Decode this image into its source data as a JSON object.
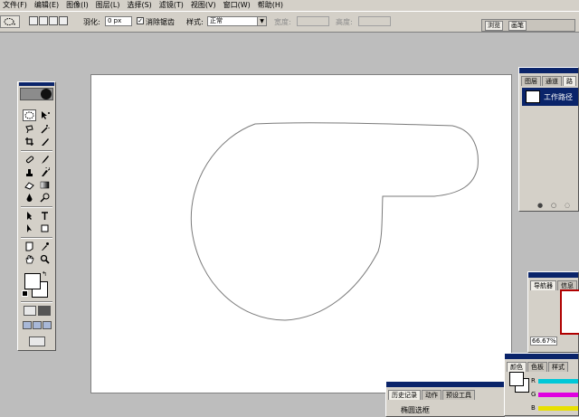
{
  "menu": [
    "文件(F)",
    "编辑(E)",
    "图像(I)",
    "图层(L)",
    "选择(S)",
    "滤镜(T)",
    "视图(V)",
    "窗口(W)",
    "帮助(H)"
  ],
  "options": {
    "feather_label": "羽化:",
    "feather_value": "0 px",
    "antialias_label": "消除锯齿",
    "antialias_checked": "✓",
    "style_label": "样式:",
    "style_value": "正常",
    "width_label": "宽度:",
    "height_label": "高度:"
  },
  "palette_well": {
    "tabs": [
      "浏览",
      "画笔"
    ]
  },
  "paths_panel": {
    "tabs": [
      "图层",
      "通道",
      "路"
    ],
    "path_item": "工作路径"
  },
  "navigator_panel": {
    "tabs": [
      "导航器",
      "信息"
    ],
    "zoom": "66.67%"
  },
  "color_panel": {
    "tabs": [
      "颜色",
      "色板",
      "样式"
    ],
    "channels": [
      "R",
      "G",
      "B"
    ],
    "channel_colors": [
      "#00c8d8",
      "#e000e0",
      "#e8e000"
    ]
  },
  "history_panel": {
    "tabs": [
      "历史记录",
      "动作",
      "预设工具"
    ],
    "item": "椭圆选框"
  },
  "colors": {
    "title_bar": "#0a246a",
    "chrome": "#d4d0c8",
    "workspace": "#bdbdbd"
  }
}
